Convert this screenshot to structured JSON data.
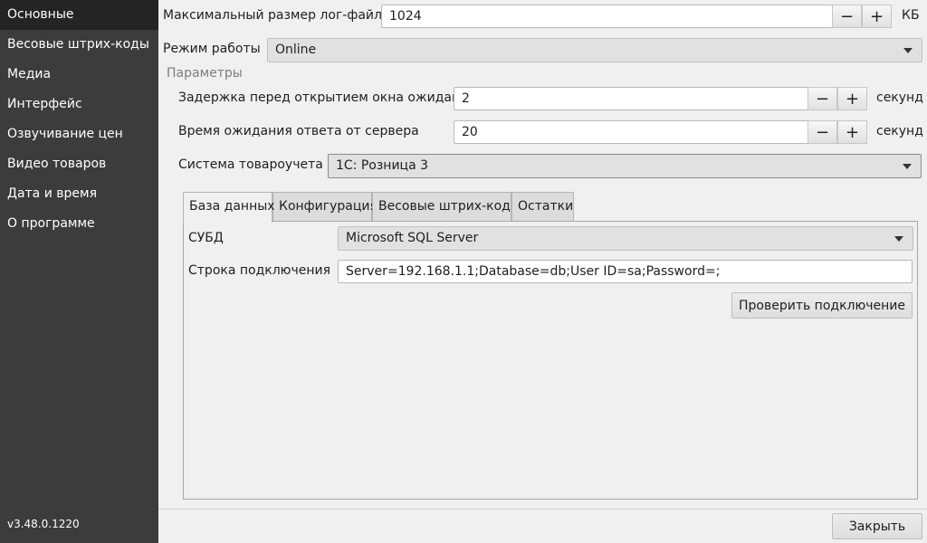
{
  "sidebar": {
    "items": [
      {
        "label": "Основные"
      },
      {
        "label": "Весовые штрих-коды"
      },
      {
        "label": "Медиа"
      },
      {
        "label": "Интерфейс"
      },
      {
        "label": "Озвучивание цен"
      },
      {
        "label": "Видео товаров"
      },
      {
        "label": "Дата и время"
      },
      {
        "label": "О программе"
      }
    ],
    "active_index": 0,
    "version": "v3.48.0.1220"
  },
  "log_size": {
    "label": "Максимальный размер лог-файла",
    "value": "1024",
    "unit": "КБ"
  },
  "mode": {
    "label": "Режим работы",
    "value": "Online"
  },
  "params": {
    "title": "Параметры",
    "delay": {
      "label": "Задержка перед открытием окна ожидания",
      "value": "2",
      "unit": "секунд"
    },
    "timeout": {
      "label": "Время ожидания ответа от сервера",
      "value": "20",
      "unit": "секунд"
    },
    "system": {
      "label": "Система товароучета",
      "value": "1С: Розница 3"
    }
  },
  "tabs": [
    {
      "label": "База данных"
    },
    {
      "label": "Конфигурация"
    },
    {
      "label": "Весовые штрих-коды"
    },
    {
      "label": "Остатки"
    }
  ],
  "db": {
    "dbms_label": "СУБД",
    "dbms_value": "Microsoft SQL Server",
    "conn_label": "Строка подключения",
    "conn_value": "Server=192.168.1.1;Database=db;User ID=sa;Password=;",
    "check_button": "Проверить подключение"
  },
  "footer": {
    "close_button": "Закрыть"
  },
  "stepper": {
    "minus": "−",
    "plus": "+"
  }
}
